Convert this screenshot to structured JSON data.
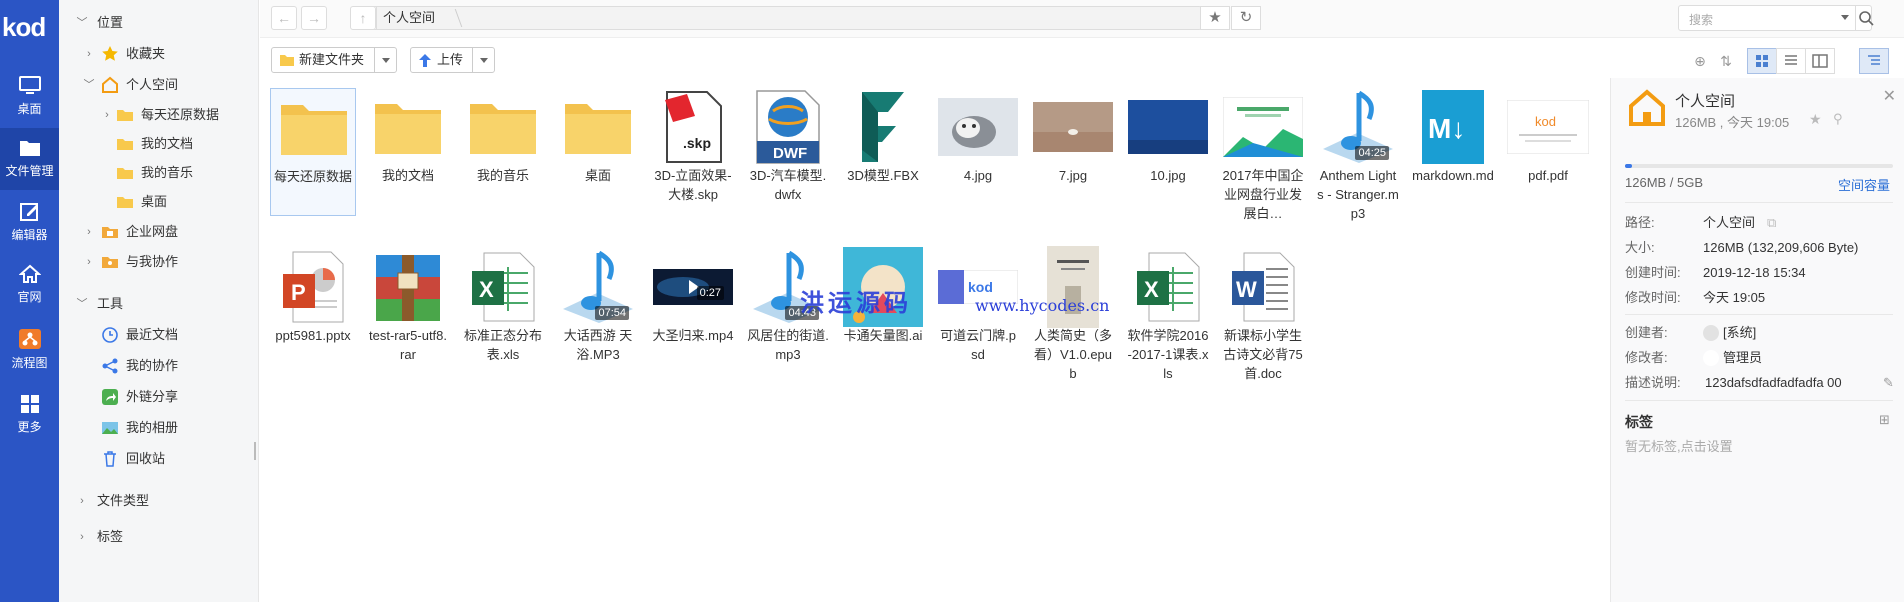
{
  "rail": {
    "logo": "kod",
    "items": [
      {
        "label": "桌面",
        "icon": "monitor-icon"
      },
      {
        "label": "文件管理",
        "icon": "folder-icon"
      },
      {
        "label": "编辑器",
        "icon": "edit-icon"
      },
      {
        "label": "官网",
        "icon": "home-icon"
      },
      {
        "label": "流程图",
        "icon": "flowchart-icon"
      },
      {
        "label": "更多",
        "icon": "grid-icon"
      }
    ]
  },
  "tree": {
    "location_label": "位置",
    "favorites": "收藏夹",
    "personal": "个人空间",
    "personal_children": [
      "每天还原数据",
      "我的文档",
      "我的音乐",
      "桌面"
    ],
    "enterprise": "企业网盘",
    "collab": "与我协作",
    "tools_label": "工具",
    "tools": [
      "最近文档",
      "我的协作",
      "外链分享",
      "我的相册",
      "回收站"
    ],
    "file_types": "文件类型",
    "tags": "标签"
  },
  "topbar": {
    "crumb": "个人空间",
    "search_placeholder": "搜索"
  },
  "toolbar": {
    "new_folder": "新建文件夹",
    "upload": "上传"
  },
  "files": [
    {
      "name": "每天还原数据",
      "type": "folder"
    },
    {
      "name": "我的文档",
      "type": "folder"
    },
    {
      "name": "我的音乐",
      "type": "folder"
    },
    {
      "name": "桌面",
      "type": "folder"
    },
    {
      "name": "3D-立面效果-大楼.skp",
      "type": "skp"
    },
    {
      "name": "3D-汽车模型.dwfx",
      "type": "dwf"
    },
    {
      "name": "3D模型.FBX",
      "type": "fbx"
    },
    {
      "name": "4.jpg",
      "type": "img-cat"
    },
    {
      "name": "7.jpg",
      "type": "img-sand"
    },
    {
      "name": "10.jpg",
      "type": "img-blue"
    },
    {
      "name": "2017年中国企业网盘行业发展白…",
      "type": "img-report"
    },
    {
      "name": "Anthem Lights - Stranger.mp3",
      "type": "music",
      "duration": "04:25"
    },
    {
      "name": "markdown.md",
      "type": "md"
    },
    {
      "name": "pdf.pdf",
      "type": "pdf"
    },
    {
      "name": "ppt5981.pptx",
      "type": "ppt"
    },
    {
      "name": "test-rar5-utf8.rar",
      "type": "rar"
    },
    {
      "name": "标准正态分布表.xls",
      "type": "xls"
    },
    {
      "name": "大话西游 天浴.MP3",
      "type": "music",
      "duration": "07:54"
    },
    {
      "name": "大圣归来.mp4",
      "type": "video",
      "duration": "0:27"
    },
    {
      "name": "风居住的街道.mp3",
      "type": "music",
      "duration": "04:43"
    },
    {
      "name": "卡通矢量图.ai",
      "type": "ai"
    },
    {
      "name": "可道云门牌.psd",
      "type": "psd"
    },
    {
      "name": "人类简史（多看）V1.0.epub",
      "type": "epub"
    },
    {
      "name": "软件学院2016-2017-1课表.xls",
      "type": "xls"
    },
    {
      "name": "新课标小学生古诗文必背75首.doc",
      "type": "doc"
    }
  ],
  "watermark": {
    "cn": "洪运源码",
    "url": "www.hycodes.cn"
  },
  "panel": {
    "title": "个人空间",
    "subtitle": "126MB , 今天 19:05",
    "usage": "126MB / 5GB",
    "usage_fraction": 0.025,
    "space_link": "空间容量",
    "path_k": "路径:",
    "path_v": "个人空间",
    "size_k": "大小:",
    "size_v": "126MB (132,209,606 Byte)",
    "created_k": "创建时间:",
    "created_v": "2019-12-18 15:34",
    "modified_k": "修改时间:",
    "modified_v": "今天 19:05",
    "creator_k": "创建者:",
    "creator_v": "[系统]",
    "modifier_k": "修改者:",
    "modifier_v": "管理员",
    "desc_k": "描述说明:",
    "desc_v": "123dafsdfadfadfadfa 00",
    "tags_h": "标签",
    "tags_empty": "暂无标签,点击设置"
  }
}
